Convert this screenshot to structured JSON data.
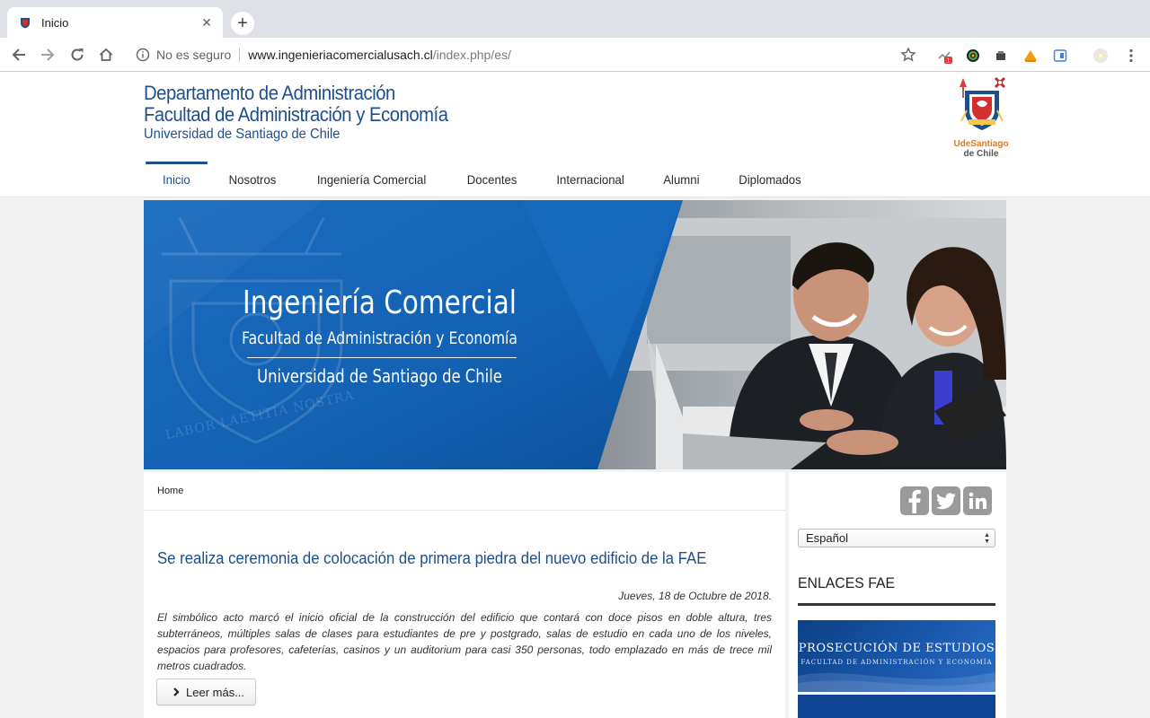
{
  "browser": {
    "tab_title": "Inicio",
    "close_glyph": "✕",
    "new_tab_glyph": "+",
    "security_label": "No es seguro",
    "url_host": "www.ingenieriacomercialusach.cl",
    "url_path": "/index.php/es/",
    "extension_badge": "1"
  },
  "header": {
    "dept_line1": "Departamento de Administración",
    "dept_line2": "Facultad de Administración y Economía",
    "dept_line3": "Universidad de Santiago de Chile",
    "logo_brand_1": "UdeSantiago",
    "logo_brand_2": "de Chile"
  },
  "nav": {
    "items": [
      "Inicio",
      "Nosotros",
      "Ingeniería Comercial",
      "Docentes",
      "Internacional",
      "Alumni",
      "Diplomados"
    ],
    "active": "Inicio"
  },
  "hero": {
    "title": "Ingeniería Comercial",
    "subtitle": "Facultad de Administración y Economía",
    "university": "Universidad de Santiago de Chile",
    "motto": "LABOR  LAETITIA  NOSTRA"
  },
  "main": {
    "breadcrumb": "Home",
    "article_title": "Se realiza ceremonia de colocación de primera piedra del nuevo edificio de la FAE",
    "article_date": "Jueves, 18 de Octubre de 2018.",
    "article_body": "El simbólico acto marcó el inicio oficial de la construcción del edificio que contará con doce pisos en doble altura, tres subterráneos, múltiples salas de clases para estudiantes de pre y postgrado, salas de estudio en cada uno de los niveles, espacios para profesores, cafeterías, casinos y un auditorium para casi 350 personas, todo emplazado en más de trece mil metros cuadrados.",
    "read_more": "Leer más..."
  },
  "sidebar": {
    "language": "Español",
    "links_heading": "ENLACES FAE",
    "banner_title": "PROSECUCIÓN DE ESTUDIOS",
    "banner_subtitle": "FACULTAD DE ADMINISTRACIÓN Y ECONOMÍA"
  },
  "colors": {
    "brand_blue": "#1f4e8c",
    "hero_blue": "#1565b8",
    "social_gray": "#9a9a9a"
  },
  "icons": {
    "social": [
      "facebook-icon",
      "twitter-icon",
      "linkedin-icon"
    ]
  }
}
